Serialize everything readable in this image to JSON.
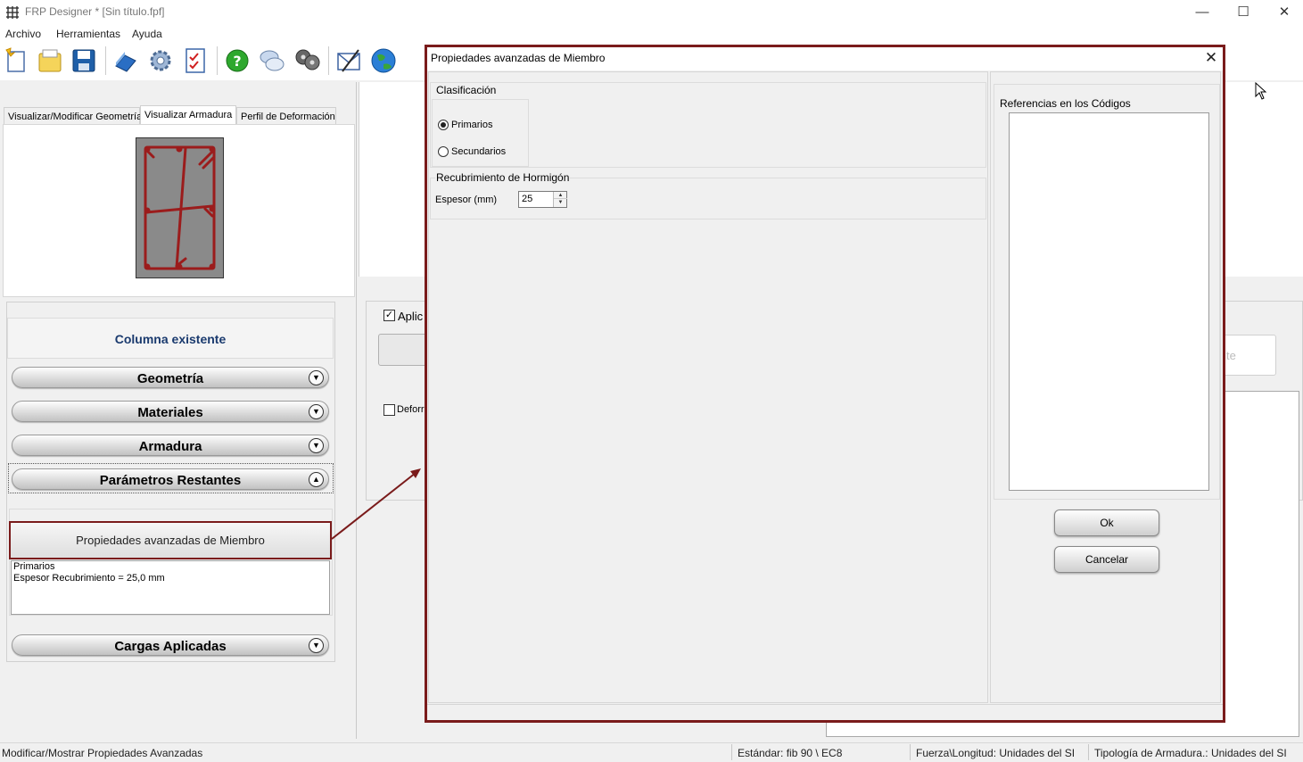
{
  "window": {
    "title": "FRP Designer * [Sin título.fpf]",
    "minimize_glyph": "—",
    "maximize_glyph": "☐",
    "close_glyph": "✕"
  },
  "menu": [
    "Archivo",
    "Herramientas",
    "Ayuda"
  ],
  "toolbar": {
    "icons": [
      "new-file-icon",
      "open-folder-icon",
      "save-icon",
      "book-icon",
      "settings-gear-icon",
      "checklist-icon",
      "help-icon",
      "chat-icon",
      "film-reel-icon",
      "email-icon",
      "globe-icon"
    ]
  },
  "left_panel": {
    "tabs": [
      "Visualizar/Modificar Geometría",
      "Visualizar Armadura",
      "Perfil de Deformación"
    ],
    "member_title": "Columna existente",
    "sections": {
      "geometria": "Geometría",
      "materiales": "Materiales",
      "armadura": "Armadura",
      "parametros": "Parámetros Restantes",
      "cargas": "Cargas Aplicadas"
    },
    "advanced_button": "Propiedades avanzadas de Miembro",
    "summary": {
      "line1": "Primarios",
      "line2": "Espesor Recubrimiento  = 25,0 mm"
    }
  },
  "background": {
    "aplic_label": "Aplic",
    "deform_label": "Deforr",
    "right_button_partial": "te"
  },
  "dialog": {
    "title": "Propiedades avanzadas de Miembro",
    "close_glyph": "✕",
    "clasificacion": {
      "label": "Clasificación",
      "options": [
        "Primarios",
        "Secundarios"
      ],
      "selected": "Primarios"
    },
    "recubrimiento": {
      "label": "Recubrimiento de Hormigón",
      "espesor_label": "Espesor (mm)",
      "espesor_value": "25"
    },
    "referencias_label": "Referencias en los Códigos",
    "ok_button": "Ok",
    "cancel_button": "Cancelar"
  },
  "status_bar": {
    "left": "Modificar/Mostrar Propiedades Avanzadas",
    "standard": "Estándar: fib 90 \\ EC8",
    "units_force": "Fuerza\\Longitud: Unidades del SI",
    "units_rebar": "Tipología de Armadura.: Unidades del SI"
  },
  "colors": {
    "highlight_border": "#7a1b1b",
    "member_title": "#1a3a6e",
    "rebar": "#9b1c1c",
    "concrete": "#8a8a8a"
  }
}
